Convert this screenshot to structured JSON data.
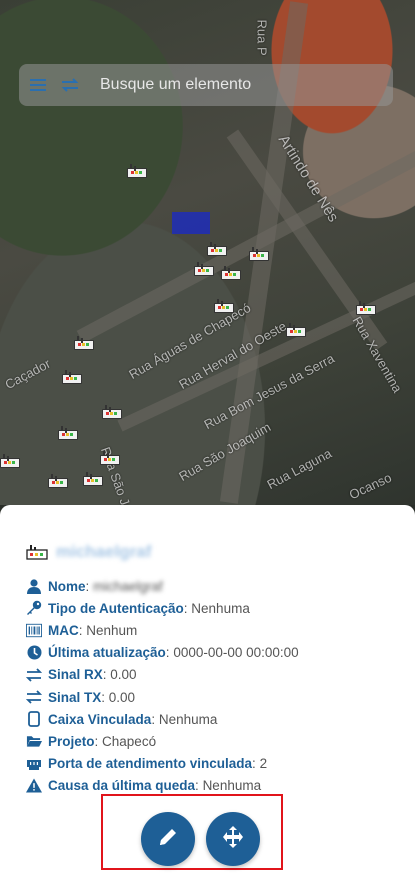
{
  "search": {
    "placeholder": "Busque um elemento",
    "menu_icon": "menu-icon",
    "swap_icon": "swap-icon"
  },
  "map": {
    "street_labels": [
      "Rua P",
      "Artindo de Nês",
      "Rua Águas de Chapecó",
      "Rua Herval do Oeste",
      "Rua Bom Jesus da Serra",
      "Rua São Joaquim",
      "Rua Laguna",
      "Rua São José",
      "Caçador",
      "Rua Xaventina",
      "Ocanso"
    ]
  },
  "panel": {
    "title": "michaelgraf",
    "rows": [
      {
        "icon": "user-icon",
        "key": "Nome",
        "value": "michaelgraf"
      },
      {
        "icon": "key-icon",
        "key": "Tipo de Autenticação",
        "value": "Nenhuma"
      },
      {
        "icon": "barcode-icon",
        "key": "MAC",
        "value": "Nenhum"
      },
      {
        "icon": "clock-icon",
        "key": "Última atualização",
        "value": "0000-00-00 00:00:00"
      },
      {
        "icon": "swap-icon",
        "key": "Sinal RX",
        "value": "0.00"
      },
      {
        "icon": "swap-icon",
        "key": "Sinal TX",
        "value": "0.00"
      },
      {
        "icon": "box-icon",
        "key": "Caixa Vinculada",
        "value": "Nenhuma"
      },
      {
        "icon": "folder-icon",
        "key": "Projeto",
        "value": "Chapecó"
      },
      {
        "icon": "ethernet-icon",
        "key": "Porta de atendimento vinculada",
        "value": "2"
      },
      {
        "icon": "warning-icon",
        "key": "Causa da última queda",
        "value": "Nenhuma"
      }
    ]
  },
  "colors": {
    "accent": "#1e5f96",
    "highlight": "#e1141b"
  }
}
